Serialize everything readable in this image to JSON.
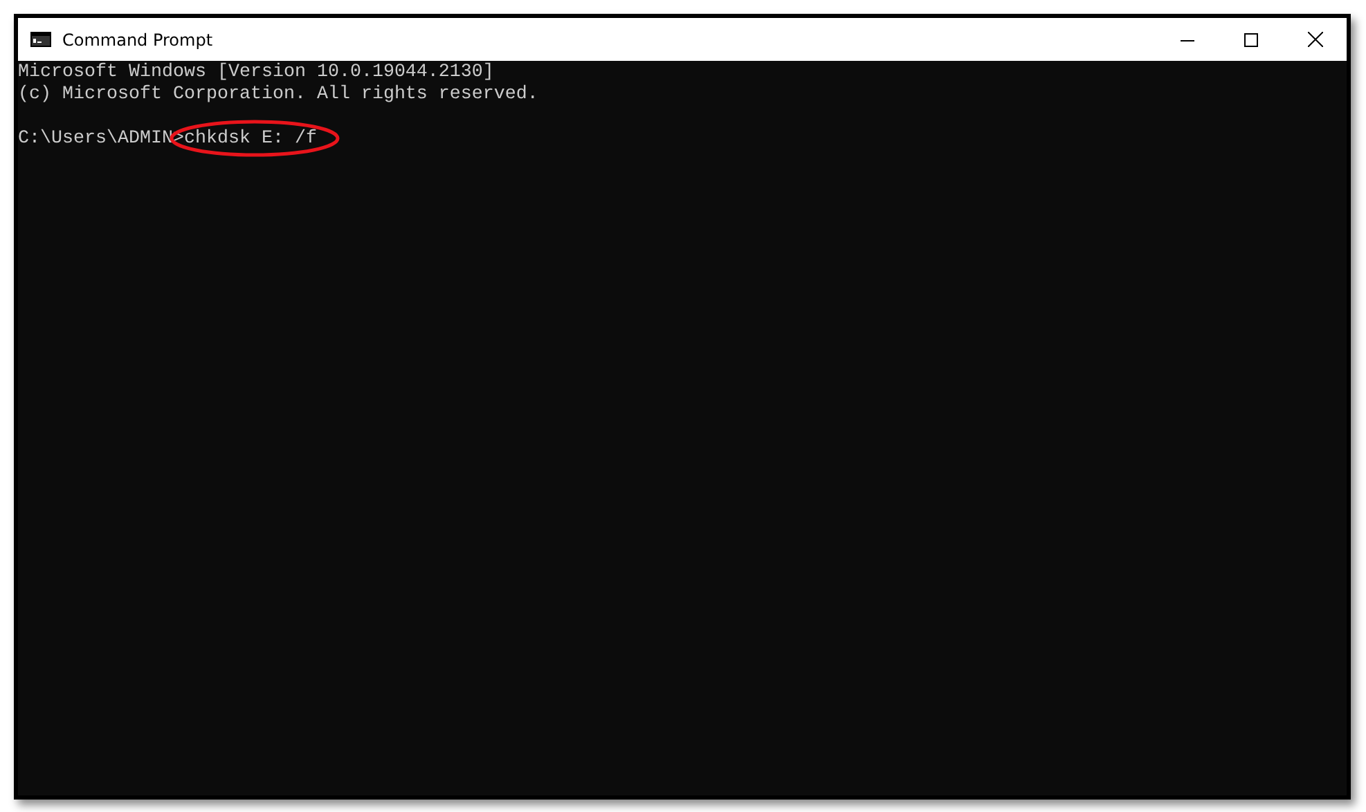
{
  "window": {
    "title": "Command Prompt"
  },
  "console": {
    "lines": [
      {
        "kind": "output",
        "text": "Microsoft Windows [Version 10.0.19044.2130]"
      },
      {
        "kind": "output",
        "text": "(c) Microsoft Corporation. All rights reserved."
      },
      {
        "kind": "input",
        "prompt": "C:\\Users\\ADMIN>",
        "command": "chkdsk E: /f",
        "highlighted": true
      }
    ]
  }
}
